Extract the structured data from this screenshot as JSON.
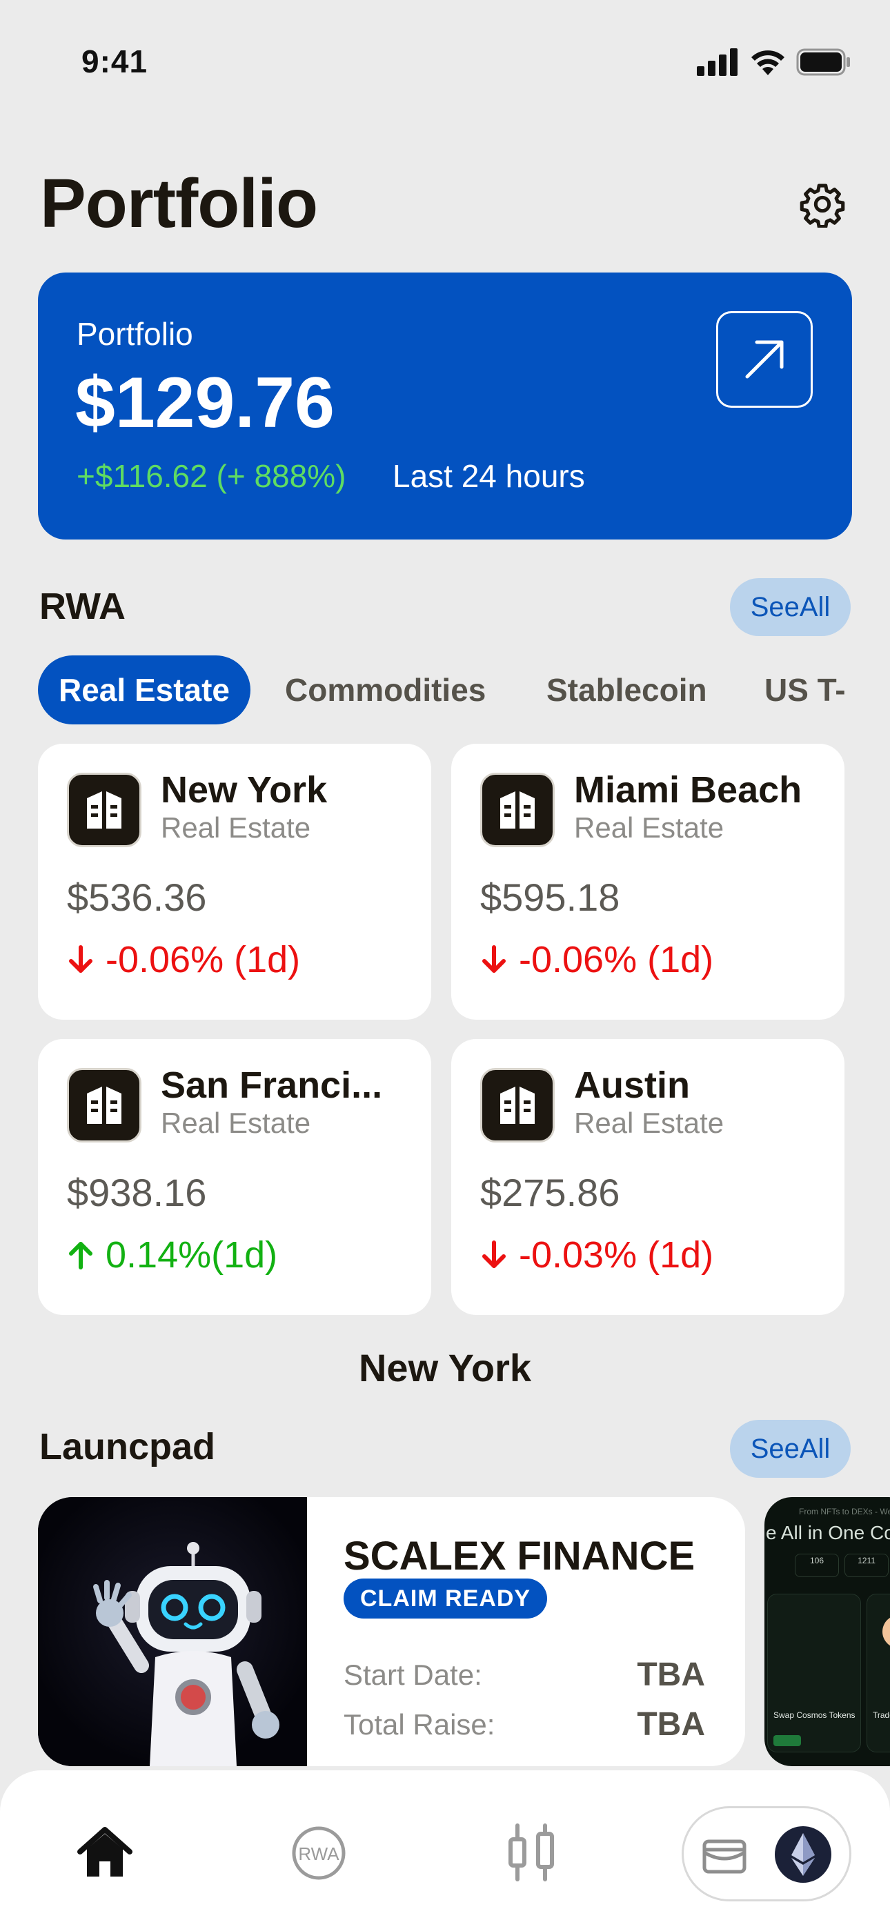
{
  "status_bar": {
    "time": "9:41"
  },
  "header": {
    "title": "Portfolio"
  },
  "portfolio_card": {
    "label": "Portfolio",
    "value": "$129.76",
    "change": "+$116.62 (+ 888%)",
    "period": "Last 24 hours"
  },
  "rwa": {
    "title": "RWA",
    "see_all": "SeeAll",
    "tabs": [
      {
        "label": "Real Estate",
        "active": true
      },
      {
        "label": "Commodities",
        "active": false
      },
      {
        "label": "Stablecoin",
        "active": false
      },
      {
        "label": "US T-",
        "active": false
      }
    ],
    "assets": [
      {
        "name": "New York",
        "category": "Real Estate",
        "price": "$536.36",
        "change": "-0.06% (1d)",
        "direction": "down"
      },
      {
        "name": "Miami Beach",
        "category": "Real Estate",
        "price": "$595.18",
        "change": "-0.06% (1d)",
        "direction": "down"
      },
      {
        "name": "San Franci...",
        "category": "Real Estate",
        "price": "$938.16",
        "change": "0.14%(1d)",
        "direction": "up"
      },
      {
        "name": "Austin",
        "category": "Real Estate",
        "price": "$275.86",
        "change": "-0.03% (1d)",
        "direction": "down"
      }
    ],
    "selected_label": "New York"
  },
  "launchpad": {
    "title": "Launcpad",
    "see_all": "SeeAll",
    "card": {
      "name": "SCALEX FINANCE",
      "badge": "CLAIM READY",
      "start_label": "Start Date:",
      "start_value": "TBA",
      "raise_label": "Total Raise:",
      "raise_value": "TBA"
    },
    "card2": {
      "caption": "From NFTs to DEXs - We've",
      "heading": "e All in One Cosm",
      "stat1": "106",
      "stat2": "1211",
      "item1": "Swap Cosmos Tokens",
      "item2": "Trade N"
    }
  },
  "tab_bar": {
    "rwa_icon_text": "RWA",
    "icons": [
      "home-icon",
      "rwa-icon",
      "chart-icon",
      "wallet-icon",
      "ethereum-icon"
    ]
  },
  "colors": {
    "brand_blue": "#0352c0",
    "positive": "#12b112",
    "negative": "#ec1111",
    "background": "#ebebeb"
  }
}
